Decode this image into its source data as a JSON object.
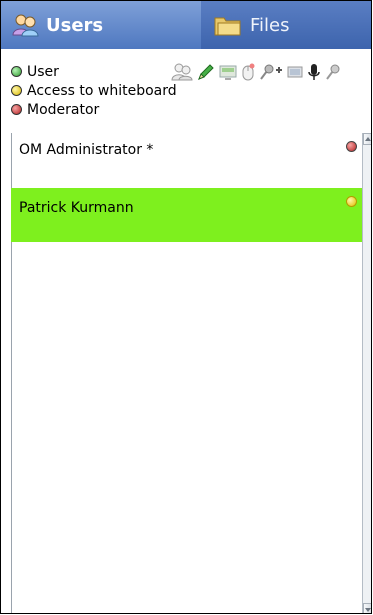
{
  "tabs": [
    {
      "label": "Users",
      "icon": "users-icon",
      "active": true
    },
    {
      "label": "Files",
      "icon": "folder-icon",
      "active": false
    }
  ],
  "legend": [
    {
      "label": "User",
      "color": "#2e9b2e"
    },
    {
      "label": "Access to whiteboard",
      "color": "#d8b800"
    },
    {
      "label": "Moderator",
      "color": "#b32121"
    }
  ],
  "toolbar_icons": [
    "users-icon",
    "pencil-icon",
    "screen-share-icon",
    "mouse-icon",
    "microphone-plus-icon",
    "screen-icon",
    "microphone-icon",
    "microphone-off-icon"
  ],
  "users": [
    {
      "name": "OM Administrator *",
      "status": "moderator",
      "status_color": "#b32121",
      "selected": false
    },
    {
      "name": "Patrick Kurmann",
      "status": "whiteboard",
      "status_color": "#e0be00",
      "selected": true,
      "highlight": "#7ef01e"
    }
  ]
}
